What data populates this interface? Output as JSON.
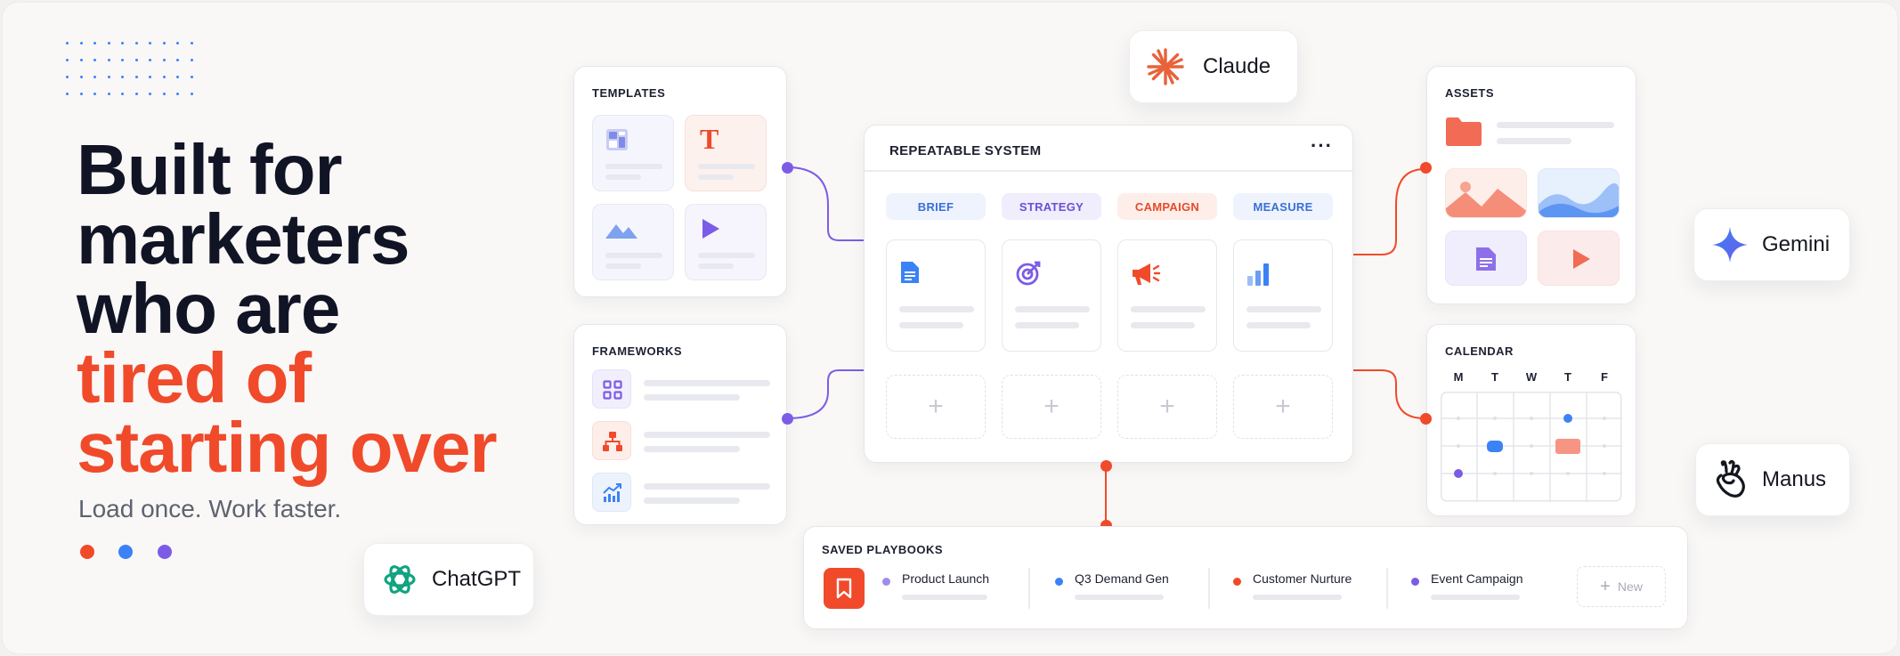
{
  "hero": {
    "line1": "Built for",
    "line2": "marketers",
    "line3": "who are",
    "line4": "tired of",
    "line5": "starting over",
    "subtitle": "Load once. Work faster."
  },
  "colors": {
    "accent": "#f04a2b",
    "blue": "#3b82f6",
    "purple": "#7c5ce6",
    "dark": "#111425"
  },
  "templates": {
    "title": "TEMPLATES"
  },
  "frameworks": {
    "title": "FRAMEWORKS"
  },
  "system": {
    "title": "REPEATABLE SYSTEM",
    "menu": "···",
    "stages": [
      "BRIEF",
      "STRATEGY",
      "CAMPAIGN",
      "MEASURE"
    ],
    "add": "+"
  },
  "assets": {
    "title": "ASSETS"
  },
  "calendar": {
    "title": "CALENDAR",
    "days": [
      "M",
      "T",
      "W",
      "T",
      "F"
    ]
  },
  "playbooks": {
    "title": "SAVED PLAYBOOKS",
    "items": [
      "Product Launch",
      "Q3 Demand Gen",
      "Customer Nurture",
      "Event Campaign"
    ],
    "new_label": "New",
    "new_icon": "+"
  },
  "ai_tools": {
    "claude": "Claude",
    "gemini": "Gemini",
    "manus": "Manus",
    "chatgpt": "ChatGPT"
  },
  "icons": [
    "dot-grid",
    "layout-icon",
    "text-icon",
    "mountains-icon",
    "play-icon",
    "grid-icon",
    "org-chart-icon",
    "chart-trend-icon",
    "document-icon",
    "target-icon",
    "megaphone-icon",
    "bar-chart-icon",
    "folder-icon",
    "wave-image-icon",
    "bookmark-icon",
    "claude-logo-icon",
    "gemini-logo-icon",
    "manus-logo-icon",
    "chatgpt-logo-icon"
  ]
}
